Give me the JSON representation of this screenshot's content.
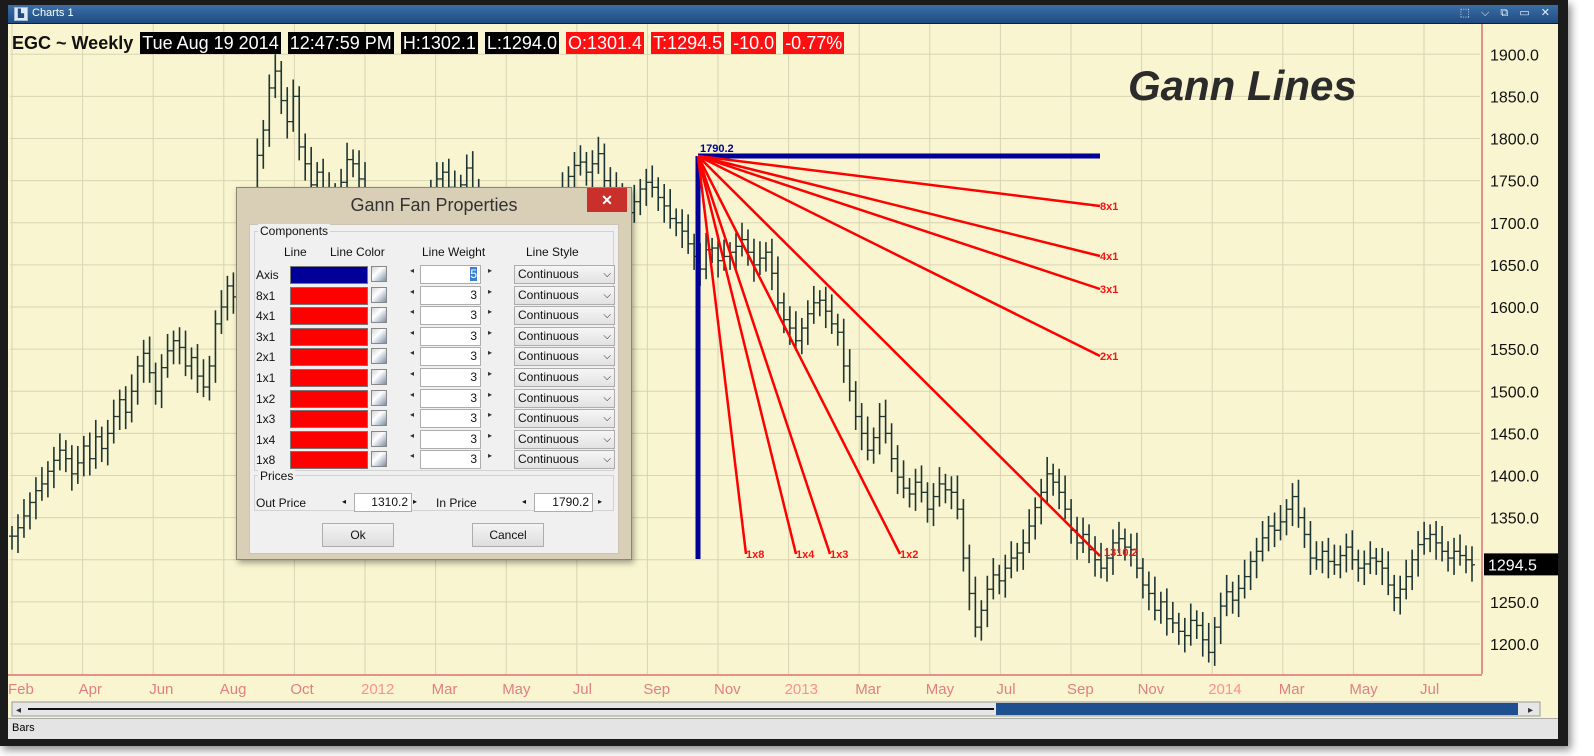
{
  "window": {
    "title": "Charts 1",
    "controls": "⬚ ⌵ ⧉ ▭ ✕"
  },
  "header": {
    "symbol": "EGC ~ Weekly",
    "date": "Tue Aug 19 2014",
    "time": "12:47:59 PM",
    "high": "H:1302.1",
    "low": "L:1294.0",
    "open": "O:1301.4",
    "last": "T:1294.5",
    "change": "-10.0",
    "pct": "-0.77%"
  },
  "overlay_title": "Gann Lines",
  "chart": {
    "axis_color": "#000099",
    "fan_color": "#ff0000",
    "price_ticks": [
      "1900.0",
      "1850.0",
      "1800.0",
      "1750.0",
      "1700.0",
      "1650.0",
      "1600.0",
      "1550.0",
      "1500.0",
      "1450.0",
      "1400.0",
      "1350.0",
      "1300.0",
      "1250.0",
      "1200.0"
    ],
    "current_price": "1294.5",
    "time_labels": [
      {
        "text": "Feb",
        "year": false
      },
      {
        "text": "Apr",
        "year": false
      },
      {
        "text": "Jun",
        "year": false
      },
      {
        "text": "Aug",
        "year": false
      },
      {
        "text": "Oct",
        "year": false
      },
      {
        "text": "2012",
        "year": true
      },
      {
        "text": "Mar",
        "year": false
      },
      {
        "text": "May",
        "year": false
      },
      {
        "text": "Jul",
        "year": false
      },
      {
        "text": "Sep",
        "year": false
      },
      {
        "text": "Nov",
        "year": false
      },
      {
        "text": "2013",
        "year": true
      },
      {
        "text": "Mar",
        "year": false
      },
      {
        "text": "May",
        "year": false
      },
      {
        "text": "Jul",
        "year": false
      },
      {
        "text": "Sep",
        "year": false
      },
      {
        "text": "Nov",
        "year": false
      },
      {
        "text": "2014",
        "year": true
      },
      {
        "text": "Mar",
        "year": false
      },
      {
        "text": "May",
        "year": false
      },
      {
        "text": "Jul",
        "year": false
      }
    ],
    "in_price_label": "1790.2",
    "out_price_label": "1310.2",
    "fan_labels": {
      "8x1": "8x1",
      "4x1": "4x1",
      "3x1": "3x1",
      "2x1": "2x1",
      "1x2": "1x2",
      "1x3": "1x3",
      "1x4": "1x4",
      "1x8": "1x8"
    },
    "price_series": [
      1328,
      1338,
      1352,
      1368,
      1382,
      1390,
      1405,
      1418,
      1430,
      1420,
      1402,
      1415,
      1435,
      1420,
      1446,
      1432,
      1450,
      1470,
      1490,
      1475,
      1500,
      1530,
      1545,
      1522,
      1500,
      1528,
      1548,
      1560,
      1552,
      1530,
      1540,
      1518,
      1505,
      1530,
      1580,
      1600,
      1625,
      1612,
      1650,
      1690,
      1720,
      1780,
      1810,
      1860,
      1880,
      1845,
      1820,
      1850,
      1790,
      1770,
      1745,
      1760,
      1740,
      1720,
      1735,
      1748,
      1775,
      1770,
      1752,
      1730,
      1700,
      1685,
      1670,
      1655,
      1640,
      1655,
      1665,
      1690,
      1705,
      1720,
      1735,
      1752,
      1760,
      1742,
      1736,
      1745,
      1765,
      1740,
      1720,
      1700,
      1680,
      1640,
      1625,
      1600,
      1605,
      1610,
      1640,
      1665,
      1678,
      1690,
      1700,
      1715,
      1740,
      1755,
      1768,
      1772,
      1760,
      1770,
      1782,
      1750,
      1740,
      1735,
      1725,
      1712,
      1725,
      1740,
      1748,
      1742,
      1730,
      1720,
      1705,
      1700,
      1690,
      1675,
      1660,
      1645,
      1668,
      1670,
      1655,
      1660,
      1665,
      1672,
      1680,
      1665,
      1650,
      1658,
      1665,
      1640,
      1605,
      1585,
      1575,
      1560,
      1575,
      1592,
      1605,
      1608,
      1595,
      1580,
      1570,
      1530,
      1500,
      1470,
      1450,
      1430,
      1445,
      1470,
      1450,
      1420,
      1398,
      1385,
      1378,
      1392,
      1380,
      1360,
      1375,
      1390,
      1383,
      1380,
      1360,
      1302,
      1260,
      1220,
      1240,
      1265,
      1282,
      1275,
      1290,
      1302,
      1308,
      1320,
      1340,
      1362,
      1380,
      1402,
      1392,
      1380,
      1360,
      1335,
      1320,
      1330,
      1312,
      1300,
      1290,
      1302,
      1320,
      1325,
      1315,
      1312,
      1290,
      1270,
      1260,
      1240,
      1250,
      1230,
      1225,
      1215,
      1210,
      1228,
      1222,
      1205,
      1190,
      1220,
      1245,
      1262,
      1252,
      1266,
      1280,
      1298,
      1310,
      1326,
      1340,
      1335,
      1345,
      1360,
      1375,
      1350,
      1330,
      1302,
      1300,
      1310,
      1298,
      1294,
      1305,
      1315,
      1300,
      1290,
      1295,
      1302,
      1298,
      1290,
      1270,
      1255,
      1265,
      1280,
      1300,
      1318,
      1325,
      1330,
      1320,
      1310,
      1302,
      1310,
      1305,
      1300,
      1294
    ]
  },
  "dialog": {
    "title": "Gann Fan Properties",
    "close": "✕",
    "components_label": "Components",
    "col_line": "Line",
    "col_color": "Line Color",
    "col_weight": "Line Weight",
    "col_style": "Line Style",
    "rows": [
      {
        "label": "Axis",
        "color": "#000099",
        "weight": "5",
        "style": "Continuous"
      },
      {
        "label": "8x1",
        "color": "#ff0000",
        "weight": "3",
        "style": "Continuous"
      },
      {
        "label": "4x1",
        "color": "#ff0000",
        "weight": "3",
        "style": "Continuous"
      },
      {
        "label": "3x1",
        "color": "#ff0000",
        "weight": "3",
        "style": "Continuous"
      },
      {
        "label": "2x1",
        "color": "#ff0000",
        "weight": "3",
        "style": "Continuous"
      },
      {
        "label": "1x1",
        "color": "#ff0000",
        "weight": "3",
        "style": "Continuous"
      },
      {
        "label": "1x2",
        "color": "#ff0000",
        "weight": "3",
        "style": "Continuous"
      },
      {
        "label": "1x3",
        "color": "#ff0000",
        "weight": "3",
        "style": "Continuous"
      },
      {
        "label": "1x4",
        "color": "#ff0000",
        "weight": "3",
        "style": "Continuous"
      },
      {
        "label": "1x8",
        "color": "#ff0000",
        "weight": "3",
        "style": "Continuous"
      }
    ],
    "prices_label": "Prices",
    "out_price_label": "Out Price",
    "out_price": "1310.2",
    "in_price_label": "In Price",
    "in_price": "1790.2",
    "ok": "Ok",
    "cancel": "Cancel"
  },
  "bottom": {
    "tab": "Bars"
  }
}
